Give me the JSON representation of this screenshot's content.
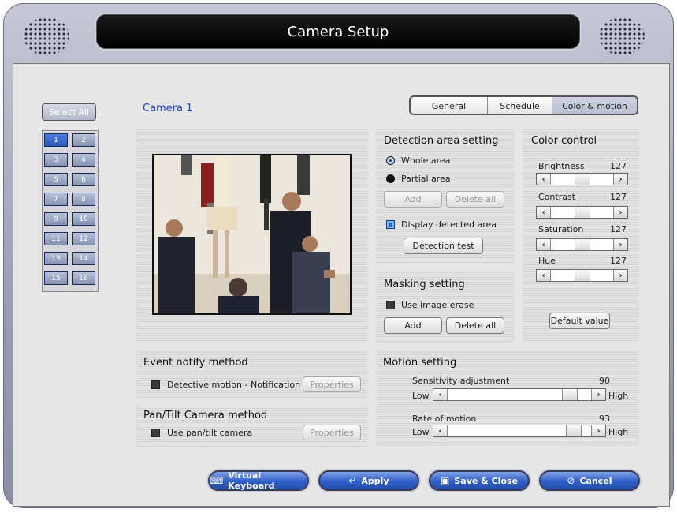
{
  "window": {
    "title": "Camera Setup"
  },
  "camera_selector": {
    "select_all_label": "Select All",
    "cameras": [
      "1",
      "2",
      "3",
      "4",
      "5",
      "6",
      "7",
      "8",
      "9",
      "10",
      "11",
      "12",
      "13",
      "14",
      "15",
      "16"
    ]
  },
  "camera_name": "Camera 1",
  "tabs": [
    {
      "label": "General"
    },
    {
      "label": "Schedule"
    },
    {
      "label": "Color & motion"
    }
  ],
  "detection": {
    "title": "Detection area setting",
    "whole_area_label": "Whole area",
    "partial_area_label": "Partial area",
    "add_label": "Add",
    "delete_all_label": "Delete all",
    "display_detected_label": "Display detected area",
    "detection_test_label": "Detection test"
  },
  "masking": {
    "title": "Masking setting",
    "use_image_erase_label": "Use image erase",
    "add_label": "Add",
    "delete_all_label": "Delete all"
  },
  "color_control": {
    "title": "Color control",
    "brightness": {
      "label": "Brightness",
      "value": "127"
    },
    "contrast": {
      "label": "Contrast",
      "value": "127"
    },
    "saturation": {
      "label": "Saturation",
      "value": "127"
    },
    "hue": {
      "label": "Hue",
      "value": "127"
    },
    "default_label": "Default value"
  },
  "event_notify": {
    "title": "Event notify method",
    "option_label": "Detective motion - Notification",
    "properties_label": "Properties"
  },
  "pantilt": {
    "title": "Pan/Tilt Camera method",
    "option_label": "Use pan/tilt camera",
    "properties_label": "Properties"
  },
  "motion": {
    "title": "Motion setting",
    "sensitivity": {
      "label": "Sensitivity adjustment",
      "value": "90",
      "low": "Low",
      "high": "High"
    },
    "rate": {
      "label": "Rate of motion",
      "value": "93",
      "low": "Low",
      "high": "High"
    }
  },
  "bottom_buttons": {
    "virtual_keyboard": "Virtual Keyboard",
    "apply": "Apply",
    "save_close": "Save & Close",
    "cancel": "Cancel"
  }
}
